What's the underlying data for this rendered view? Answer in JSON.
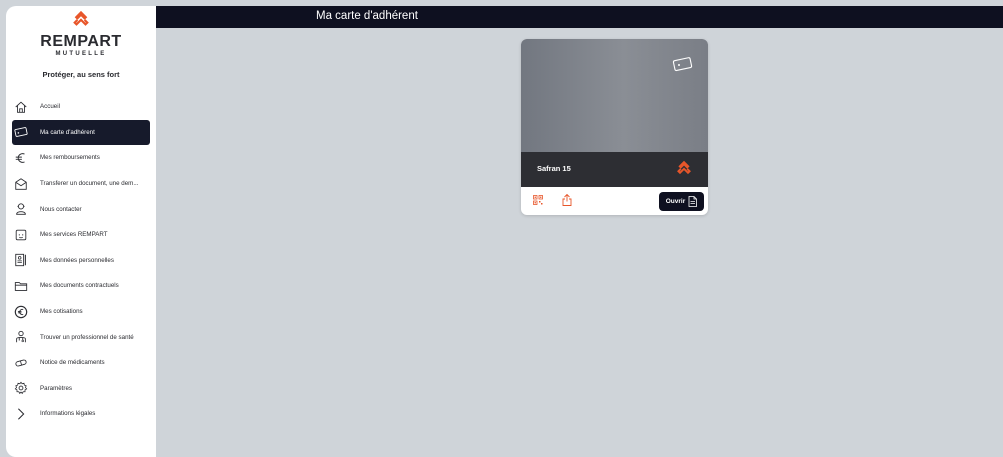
{
  "brand": {
    "name": "REMPART",
    "subtitle": "MUTUELLE",
    "tagline": "Protéger, au sens fort",
    "accent_color": "#e8562a"
  },
  "header": {
    "title": "Ma carte d'adhérent"
  },
  "sidebar": {
    "items": [
      {
        "label": "Accueil",
        "icon": "home-icon",
        "active": false
      },
      {
        "label": "Ma carte d'adhérent",
        "icon": "card-icon",
        "active": true
      },
      {
        "label": "Mes remboursements",
        "icon": "euro-icon",
        "active": false
      },
      {
        "label": "Transferer un document, une dem...",
        "icon": "envelope-icon",
        "active": false
      },
      {
        "label": "Nous contacter",
        "icon": "contact-icon",
        "active": false
      },
      {
        "label": "Mes services REMPART",
        "icon": "services-icon",
        "active": false
      },
      {
        "label": "Mes données personnelles",
        "icon": "personal-data-icon",
        "active": false
      },
      {
        "label": "Mes documents contractuels",
        "icon": "folder-icon",
        "active": false
      },
      {
        "label": "Mes cotisations",
        "icon": "euro-circle-icon",
        "active": false
      },
      {
        "label": "Trouver un professionnel de santé",
        "icon": "doctor-icon",
        "active": false
      },
      {
        "label": "Notice de médicaments",
        "icon": "pill-icon",
        "active": false
      },
      {
        "label": "Paramètres",
        "icon": "gear-icon",
        "active": false
      },
      {
        "label": "Informations légales",
        "icon": "chevron-right-icon",
        "active": false
      }
    ]
  },
  "card": {
    "name": "Safran 15",
    "open_label": "Ouvrir"
  }
}
